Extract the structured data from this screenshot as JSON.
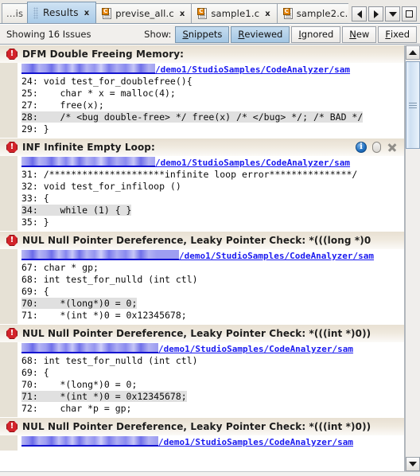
{
  "window": {
    "title": "Results"
  },
  "tabbar": {
    "partial_tab_label": "...is",
    "tabs": [
      {
        "label": "Results",
        "icon": "none",
        "active": true,
        "closable": true
      },
      {
        "label": "previse_all.c",
        "icon": "c-file-icon",
        "active": false,
        "closable": true
      },
      {
        "label": "sample1.c",
        "icon": "c-file-icon",
        "active": false,
        "closable": true
      },
      {
        "label": "sample2.c...",
        "icon": "c-file-icon",
        "active": false,
        "closable": false
      }
    ],
    "close_glyph": "x",
    "file_badge_letter": "C",
    "nav": [
      {
        "name": "scroll-tabs-left-button",
        "icon": "triangle-left-icon"
      },
      {
        "name": "scroll-tabs-right-button",
        "icon": "triangle-right-icon"
      },
      {
        "name": "tab-list-dropdown-button",
        "icon": "chevron-down-icon"
      },
      {
        "name": "maximize-tab-button",
        "icon": "square-icon"
      }
    ]
  },
  "toolbar": {
    "showing_text": "Showing 16 Issues",
    "show_label": "Show:",
    "filters": [
      {
        "label": "Snippets",
        "mnemonic": "S",
        "selected": true
      },
      {
        "label": "Reviewed",
        "mnemonic": "R",
        "selected": true
      },
      {
        "label": "Ignored",
        "mnemonic": "I",
        "selected": false
      },
      {
        "label": "New",
        "mnemonic": "N",
        "selected": false
      },
      {
        "label": "Fixed",
        "mnemonic": "F",
        "selected": false
      }
    ]
  },
  "issues": [
    {
      "severity_icon": "error-icon",
      "title": "DFM Double Freeing Memory:",
      "path_visible": "/demo1/StudioSamples/CodeAnalyzer/sam",
      "path_redacted": true,
      "header_icons": [],
      "lines": [
        {
          "num": "24",
          "text": "void test_for_doublefree(){",
          "highlighted": false
        },
        {
          "num": "25",
          "text": "   char * x = malloc(4);",
          "highlighted": false
        },
        {
          "num": "27",
          "text": "   free(x);",
          "highlighted": false
        },
        {
          "num": "28",
          "text": "   /* <bug double-free> */ free(x) /* </bug> */; /* BAD */",
          "highlighted": true
        },
        {
          "num": "29",
          "text": "}",
          "highlighted": false
        }
      ]
    },
    {
      "severity_icon": "error-icon",
      "title": "INF Infinite Empty Loop:",
      "path_visible": "/demo1/StudioSamples/CodeAnalyzer/sam",
      "path_redacted": true,
      "header_icons": [
        "info-icon",
        "pill-icon",
        "close-x-icon"
      ],
      "lines": [
        {
          "num": "31",
          "text": "/*********************infinite loop error***************/",
          "highlighted": false
        },
        {
          "num": "32",
          "text": "void test_for_infiloop ()",
          "highlighted": false
        },
        {
          "num": "33",
          "text": "{",
          "highlighted": false
        },
        {
          "num": "34",
          "text": "   while (1) { }",
          "highlighted": true
        },
        {
          "num": "35",
          "text": "}",
          "highlighted": false
        }
      ]
    },
    {
      "severity_icon": "error-icon",
      "title": "NUL Null Pointer Dereference, Leaky Pointer Check: *(((long *)0",
      "path_visible": "/demo1/StudioSamples/CodeAnalyzer/sam",
      "path_redacted": true,
      "header_icons": [],
      "lines": [
        {
          "num": "67",
          "text": "char * gp;",
          "highlighted": false
        },
        {
          "num": "68",
          "text": "int test_for_nulld (int ctl)",
          "highlighted": false
        },
        {
          "num": "69",
          "text": "{",
          "highlighted": false
        },
        {
          "num": "70",
          "text": "   *(long*)0 = 0;",
          "highlighted": true
        },
        {
          "num": "71",
          "text": "   *(int *)0 = 0x12345678;",
          "highlighted": false
        }
      ]
    },
    {
      "severity_icon": "error-icon",
      "title": "NUL Null Pointer Dereference, Leaky Pointer Check: *(((int *)0))",
      "path_visible": "/demo1/StudioSamples/CodeAnalyzer/sam",
      "path_redacted": true,
      "header_icons": [],
      "lines": [
        {
          "num": "68",
          "text": "int test_for_nulld (int ctl)",
          "highlighted": false
        },
        {
          "num": "69",
          "text": "{",
          "highlighted": false
        },
        {
          "num": "70",
          "text": "   *(long*)0 = 0;",
          "highlighted": false
        },
        {
          "num": "71",
          "text": "   *(int *)0 = 0x12345678;",
          "highlighted": true
        },
        {
          "num": "72",
          "text": "   char *p = gp;",
          "highlighted": false
        }
      ]
    },
    {
      "severity_icon": "error-icon",
      "title": "NUL Null Pointer Dereference, Leaky Pointer Check: *(((int *)0))",
      "path_visible": "/demo1/StudioSamples/CodeAnalyzer/sam",
      "path_redacted": true,
      "header_icons": [],
      "lines": []
    }
  ],
  "scrollbar": {
    "up_icon": "triangle-up-icon",
    "down_icon": "triangle-down-icon",
    "thumb_position_pct": 2,
    "thumb_size_pct": 22
  },
  "colors": {
    "accent_selected": "#a4c6e3",
    "error_red": "#d2232a",
    "link_blue": "#1a1af0",
    "header_tan": "#e8e0d2",
    "highlight_gray": "#e2e2e2"
  }
}
